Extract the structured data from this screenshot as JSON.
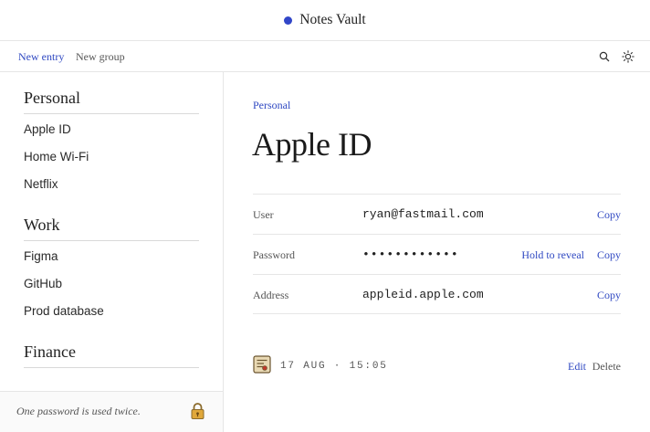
{
  "app": {
    "title": "Notes Vault",
    "accent_color": "#3146c8"
  },
  "toolbar": {
    "new_entry": "New entry",
    "new_group": "New group",
    "search_icon": "search-icon",
    "theme_icon": "sun-icon"
  },
  "sidebar": {
    "groups": [
      {
        "title": "Personal",
        "items": [
          "Apple ID",
          "Home Wi-Fi",
          "Netflix"
        ]
      },
      {
        "title": "Work",
        "items": [
          "Figma",
          "GitHub",
          "Prod database"
        ]
      },
      {
        "title": "Finance",
        "items": []
      }
    ],
    "footer_text": "One password is used twice.",
    "footer_icon": "lock-icon"
  },
  "entry": {
    "group": "Personal",
    "title": "Apple ID",
    "fields": [
      {
        "label": "User",
        "value": "ryan@fastmail.com",
        "action": "Copy"
      },
      {
        "label": "Password",
        "value": "••••••••••••",
        "reveal": "Hold to reveal",
        "action": "Copy"
      },
      {
        "label": "Address",
        "value": "appleid.apple.com",
        "action": "Copy"
      }
    ],
    "meta_icon": "note-icon",
    "modified": "17 AUG · 15:05",
    "edit_label": "Edit",
    "delete_label": "Delete"
  }
}
